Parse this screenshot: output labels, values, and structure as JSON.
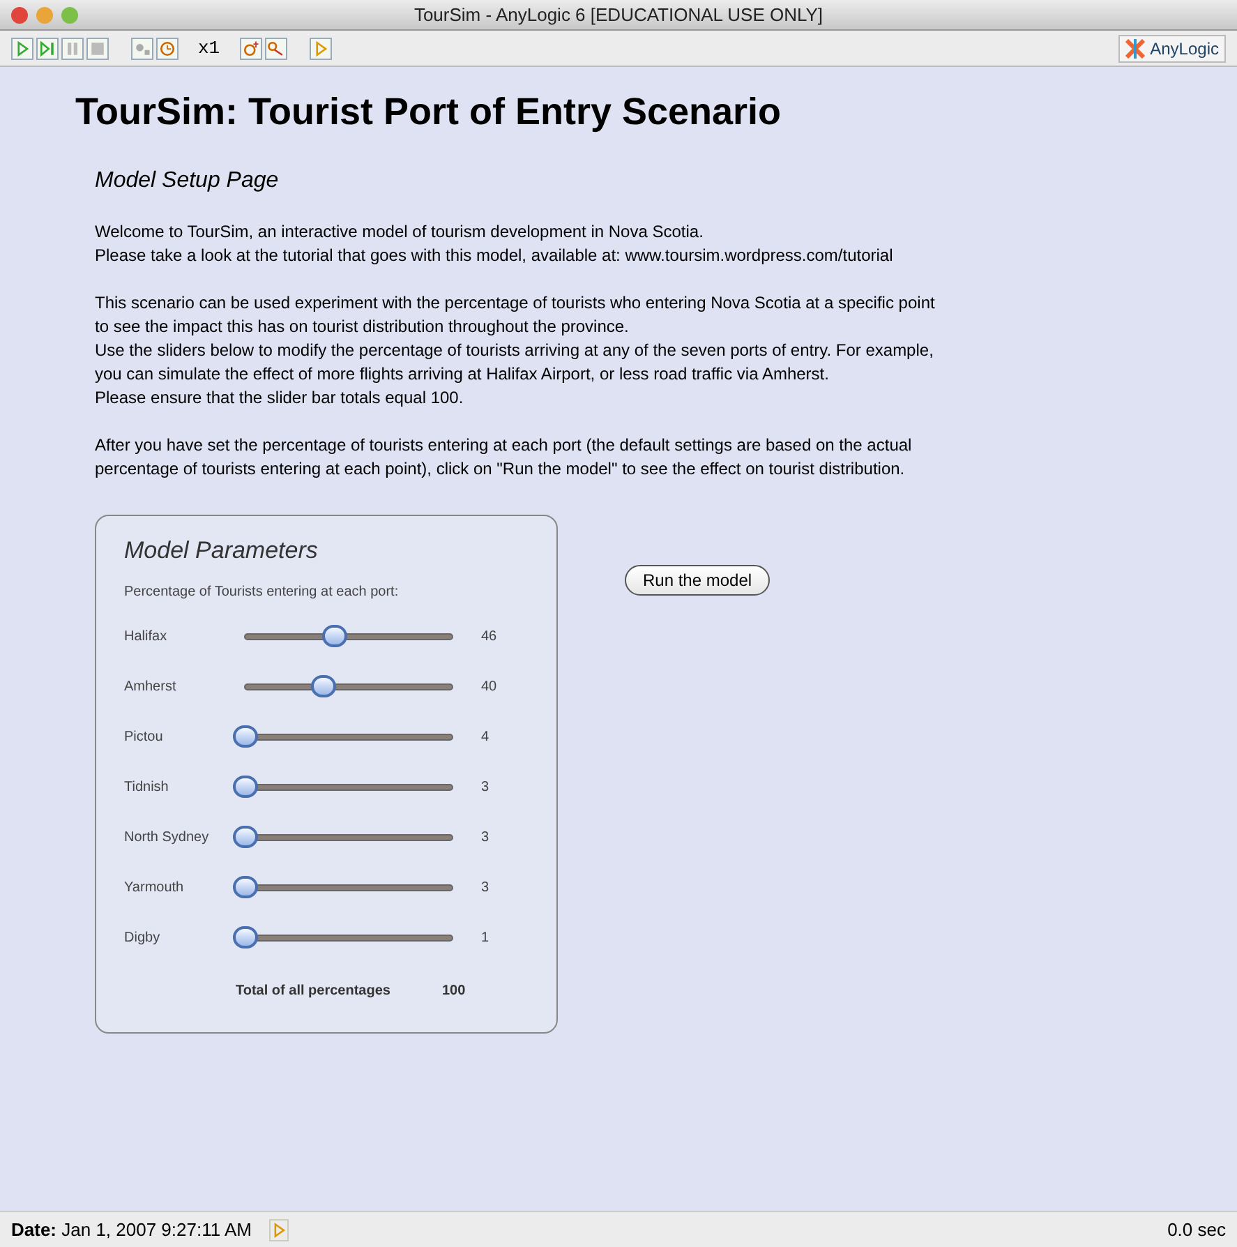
{
  "window": {
    "title": "TourSim  - AnyLogic 6 [EDUCATIONAL USE ONLY]"
  },
  "toolbar": {
    "speed": "x1",
    "brand": "AnyLogic"
  },
  "page": {
    "title": "TourSim: Tourist Port of Entry Scenario",
    "subtitle": "Model Setup Page",
    "paragraphs": [
      [
        "Welcome to TourSim, an interactive model of tourism development in Nova Scotia.",
        "Please take a look at the tutorial that goes with this model, available at:  www.toursim.wordpress.com/tutorial"
      ],
      [
        "This scenario can be used experiment with the percentage of tourists who entering Nova Scotia at a specific point",
        "to see the impact this has on tourist distribution throughout the province.",
        "Use the sliders below to modify the percentage of tourists arriving at any of the seven ports of entry.  For example,",
        "you can simulate the effect of more flights arriving at Halifax Airport, or less road traffic via Amherst.",
        "Please ensure that the slider bar totals equal 100."
      ],
      [
        "After you have set the percentage of tourists entering at each port (the default settings are based on the actual",
        "percentage of tourists entering at each point), click on \"Run the model\" to see the effect on tourist distribution."
      ]
    ]
  },
  "parameters": {
    "title": "Model Parameters",
    "caption": "Percentage of Tourists entering at each port:",
    "sliders": [
      {
        "name": "Halifax",
        "level": 0.46,
        "reading": "46"
      },
      {
        "name": "Amherst",
        "level": 0.4,
        "reading": "40"
      },
      {
        "name": "Pictou",
        "level": 0.0,
        "reading": "4"
      },
      {
        "name": "Tidnish",
        "level": 0.0,
        "reading": "3"
      },
      {
        "name": "North Sydney",
        "level": 0.0,
        "reading": "3"
      },
      {
        "name": "Yarmouth",
        "level": 0.0,
        "reading": "3"
      },
      {
        "name": "Digby",
        "level": 0.0,
        "reading": "1"
      }
    ],
    "total_label": "Total of all percentages",
    "total": "100"
  },
  "run_button": "Run the model",
  "status_bar": {
    "date": "**Date:** Jan 1, 2007 9:27:11 AM",
    "time": "0.0 sec"
  }
}
